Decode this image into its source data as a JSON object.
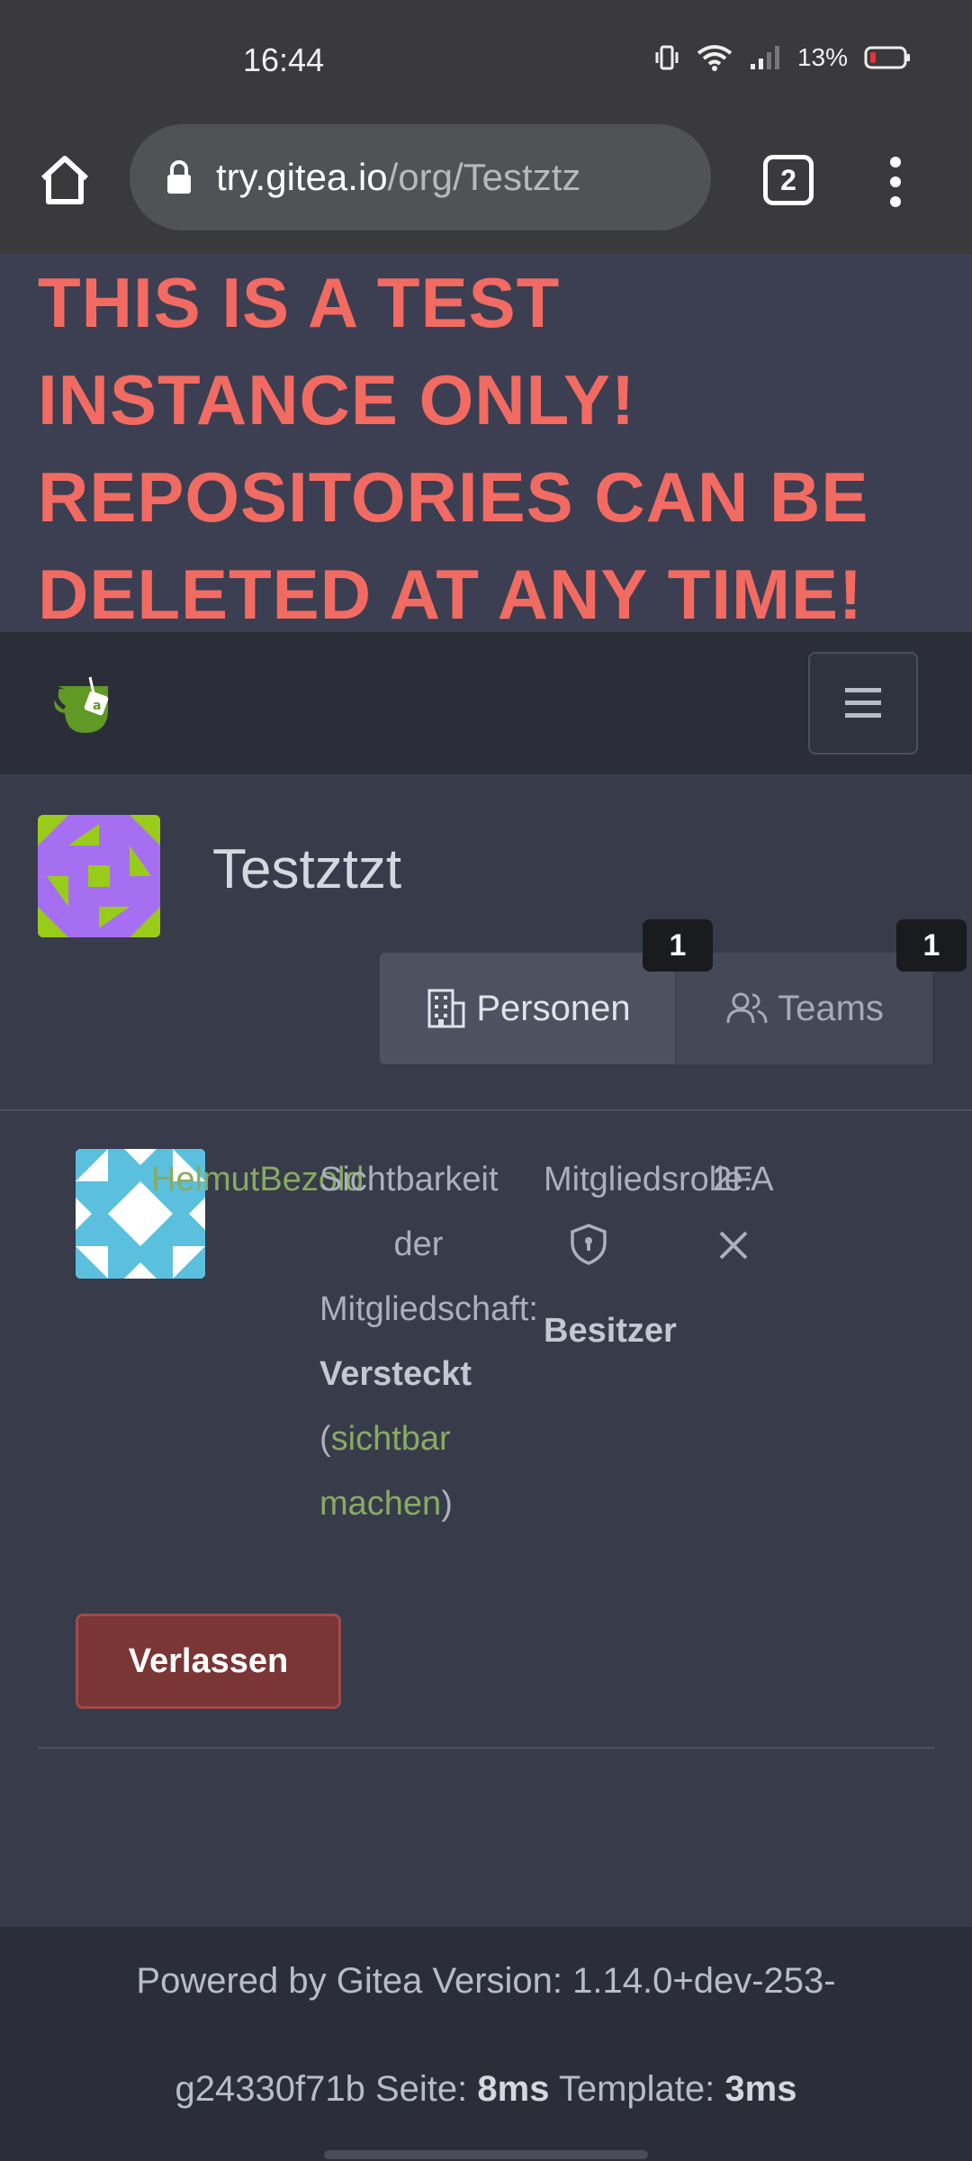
{
  "status_bar": {
    "time": "16:44",
    "battery": "13%"
  },
  "browser": {
    "url_host": "try.gitea.io",
    "url_path": "/org/Testztz",
    "tab_count": "2"
  },
  "banner": {
    "text": "THIS IS A TEST INSTANCE ONLY! REPOSITORIES CAN BE DELETED AT ANY TIME!"
  },
  "org": {
    "name": "Testztzt"
  },
  "tabs": [
    {
      "label": "Personen",
      "count": "1"
    },
    {
      "label": "Teams",
      "count": "1"
    }
  ],
  "member": {
    "name": "HelmutBezold",
    "visibility_header": "Sichtbarkeit der Mitgliedschaft:",
    "visibility_header_1": "Sichtbarkeit",
    "visibility_header_2": "der",
    "visibility_header_3": "Mitgliedschaft:",
    "visibility_value": "Versteckt",
    "visibility_link_open": "(",
    "visibility_link_1": "sichtbar",
    "visibility_link_2": "machen",
    "visibility_link_close": ")",
    "role_header": "Mitgliedsrolle:",
    "role_value": "Besitzer",
    "twofa_header": "2FA"
  },
  "actions": {
    "leave_label": "Verlassen"
  },
  "footer": {
    "powered_by": "Powered by Gitea Version: 1.14.0+dev-253-",
    "line2_prefix": "g24330f71b Seite: ",
    "page_time": "8ms",
    "template_label": " Template: ",
    "template_time": "3ms"
  },
  "colors": {
    "banner_text": "#f26b62",
    "link_green": "#87ab63",
    "danger_button": "#7a3535"
  }
}
